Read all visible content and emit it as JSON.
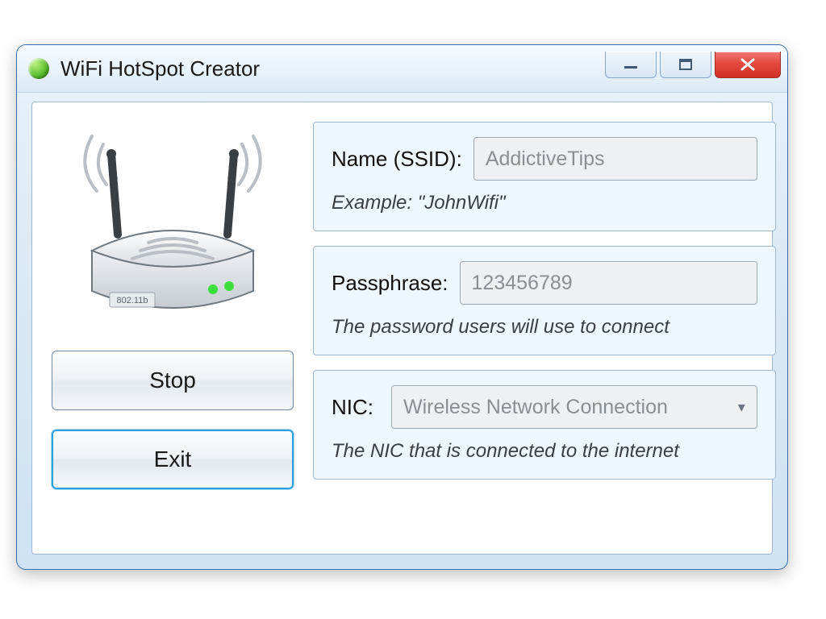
{
  "window": {
    "title": "WiFi HotSpot Creator"
  },
  "router": {
    "port_label": "802.11b"
  },
  "buttons": {
    "stop": "Stop",
    "exit": "Exit"
  },
  "ssid": {
    "label": "Name (SSID):",
    "value": "AddictiveTips",
    "hint": "Example: \"JohnWifi\""
  },
  "passphrase": {
    "label": "Passphrase:",
    "value": "123456789",
    "hint": "The password users will use to connect"
  },
  "nic": {
    "label": "NIC:",
    "selected": "Wireless Network Connection",
    "hint": "The NIC that is connected to the internet"
  }
}
